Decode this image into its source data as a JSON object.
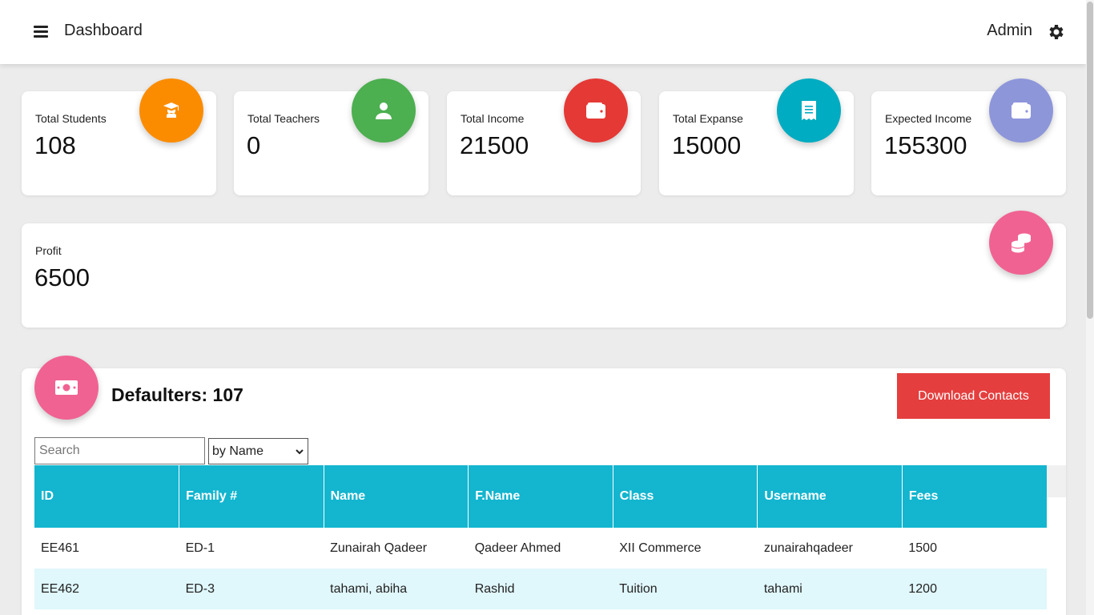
{
  "header": {
    "title": "Dashboard",
    "user": "Admin"
  },
  "stats": [
    {
      "label": "Total Students",
      "value": "108",
      "color": "#fb8c00",
      "icon": "graduate-icon"
    },
    {
      "label": "Total Teachers",
      "value": "0",
      "color": "#4caf50",
      "icon": "user-icon"
    },
    {
      "label": "Total Income",
      "value": "21500",
      "color": "#e53935",
      "icon": "wallet-icon"
    },
    {
      "label": "Total Expanse",
      "value": "15000",
      "color": "#00acc1",
      "icon": "receipt-icon"
    },
    {
      "label": "Expected Income",
      "value": "155300",
      "color": "#8e96da",
      "icon": "wallet-icon"
    }
  ],
  "profit": {
    "label": "Profit",
    "value": "6500",
    "color": "#f06292",
    "icon": "coins-icon"
  },
  "defaulters": {
    "title": "Defaulters: 107",
    "icon_color": "#f06292",
    "download_label": "Download Contacts",
    "search_placeholder": "Search",
    "filter_selected": "by Name",
    "columns": [
      "ID",
      "Family #",
      "Name",
      "F.Name",
      "Class",
      "Username",
      "Fees"
    ],
    "rows": [
      [
        "EE461",
        "ED-1",
        "Zunairah Qadeer",
        "Qadeer Ahmed",
        "XII Commerce",
        "zunairahqadeer",
        "1500"
      ],
      [
        "EE462",
        "ED-3",
        "tahami, abiha",
        "Rashid",
        "Tuition",
        "tahami",
        "1200"
      ]
    ]
  }
}
